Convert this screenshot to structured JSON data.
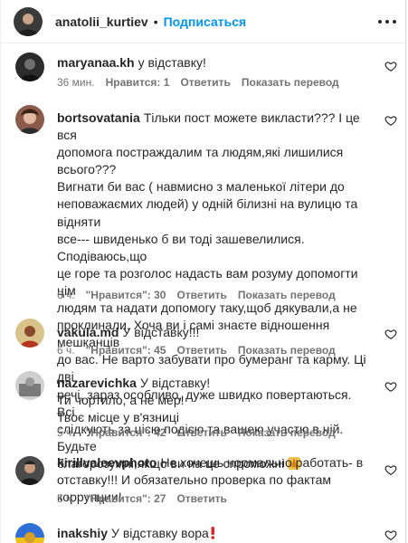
{
  "header": {
    "username": "anatolii_kurtiev",
    "separator": "•",
    "follow_label": "Подписаться"
  },
  "comments": [
    {
      "username": "maryanaa.kh",
      "text": "у відставку!",
      "time": "36 мин.",
      "likes": "Нравится: 1",
      "reply": "Ответить",
      "translate": "Показать перевод"
    },
    {
      "username": "bortsovatania",
      "lines": [
        "Тільки пост можете викласти??? І це вся",
        "допомога постраждалим та людям,які лишилися всього???",
        "Вигнати би вас ( навмисно з маленької літери до",
        "неповажаємих людей) у одній білизні на вулицю та відняти",
        "все--- швиденько б ви тоді зашевелилися. Сподіваюсь,що",
        "це горе та розголос надасть вам розуму допомогти цім",
        "людям та надати допомогу таку,щоб дякували,а не",
        "проклинали. Хоча ви і самі знаєте відношення мешканців",
        "до вас. Не варто забувати про бумеранг та карму. Ці дві",
        "речі, зараз особливо, дуже швидко повертаються. Всі",
        "слідкують за цією подією та вашею участю в ній. Будьте",
        "благорозумні,якщо ви на це спроможні"
      ],
      "emoji": "praying-hands",
      "time": "6 ч.",
      "likes": "\"Нравится\": 30",
      "reply": "Ответить",
      "translate": "Показать перевод"
    },
    {
      "username": "vakula.md",
      "text": "У відставку!!!",
      "time": "6 ч.",
      "likes": "\"Нравится\": 45",
      "reply": "Ответить",
      "translate": "Показать перевод"
    },
    {
      "username": "nazarevichka",
      "lines": [
        "У відставку!",
        "Ти чортило, а не мер!",
        "Твоє місце у в'язниці"
      ],
      "time": "5 ч.",
      "likes": "\"Нравится\": 42",
      "reply": "Ответить",
      "translate": "Показать перевод"
    },
    {
      "username": "kirillvaleevphoto",
      "lines": [
        "Не хочешь нормально работать- в",
        "отставку!!! И обязательно проверка по фактам коррупции!"
      ],
      "time": "5 ч.",
      "likes": "\"Нравится\": 27",
      "reply": "Ответить"
    },
    {
      "username": "inakshiy",
      "text": "У відставку вора",
      "emoji": "red-exclamation"
    }
  ],
  "colors": {
    "text": "#262626",
    "muted": "#737373",
    "link": "#0095f6"
  }
}
